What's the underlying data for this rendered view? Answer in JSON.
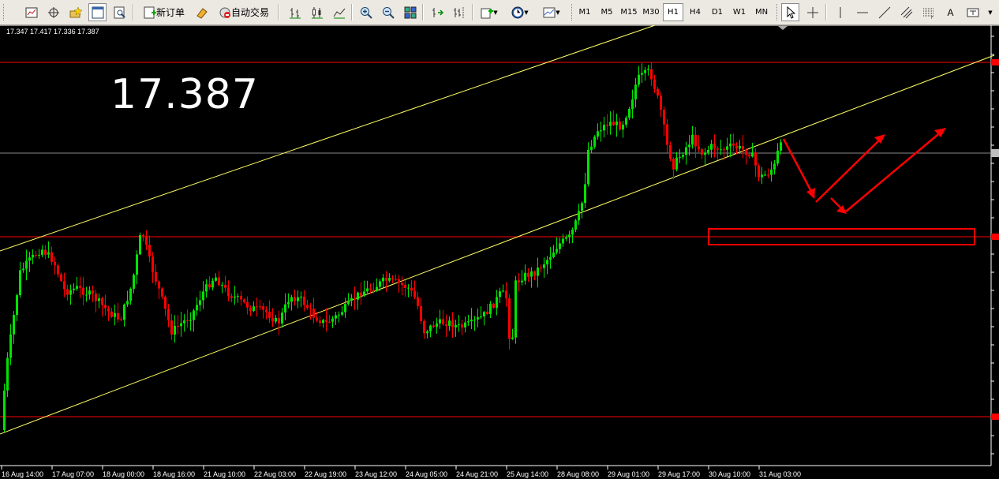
{
  "toolbar": {
    "new_order_label": "新订单",
    "auto_trading_label": "自动交易",
    "timeframes": [
      "M1",
      "M5",
      "M15",
      "M30",
      "H1",
      "H4",
      "D1",
      "W1",
      "MN"
    ],
    "active_timeframe": "H1",
    "text_tool": "A"
  },
  "chart": {
    "ohlc_readout": "17.347 17.417 17.336 17.387",
    "current_price_big": "17.387",
    "bull_color": "#00e400",
    "bear_color": "#ff0000",
    "trendline_color": "#ffff66",
    "level_color": "#ff0000",
    "time_labels": [
      "16 Aug 14:00",
      "17 Aug 07:00",
      "18 Aug 00:00",
      "18 Aug 16:00",
      "21 Aug 10:00",
      "22 Aug 03:00",
      "22 Aug 19:00",
      "23 Aug 12:00",
      "24 Aug 05:00",
      "24 Aug 21:00",
      "25 Aug 14:00",
      "28 Aug 08:00",
      "29 Aug 01:00",
      "29 Aug 17:00",
      "30 Aug 10:00",
      "31 Aug 03:00"
    ]
  }
}
